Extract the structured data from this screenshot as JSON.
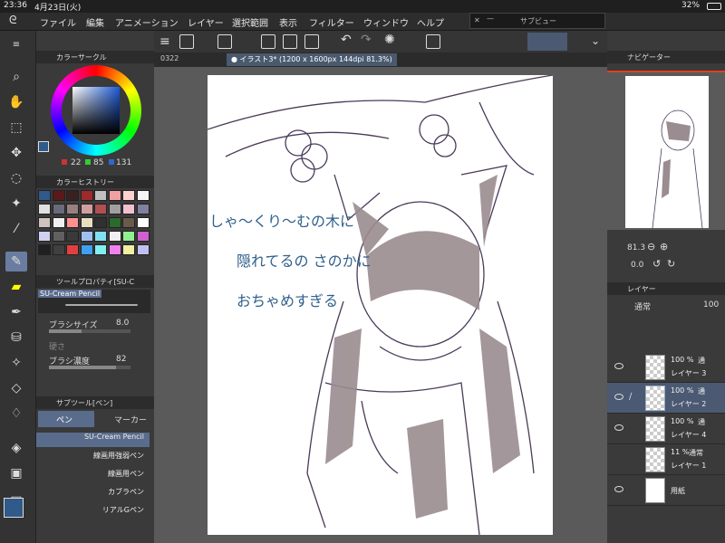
{
  "status": {
    "time": "23:36",
    "date": "4月23日(火)",
    "battery": "32%"
  },
  "menu": [
    "ファイル",
    "編集",
    "アニメーション",
    "レイヤー",
    "選択範囲",
    "表示",
    "フィルター",
    "ウィンドウ",
    "ヘルプ"
  ],
  "subview": {
    "title": "サブビュー"
  },
  "tabs": {
    "other": "0322",
    "active": "● イラスト3* (1200 x 1600px 144dpi 81.3%)"
  },
  "color_circle": {
    "title": "カラーサークル",
    "r": "22",
    "g": "85",
    "b": "131",
    "main_color": "#2f5a8a"
  },
  "color_history": {
    "title": "カラーヒストリー",
    "colors": [
      "#2f5a8a",
      "#5a1a1a",
      "#3a2020",
      "#9e2a2a",
      "#c0c0c0",
      "#f0a0a0",
      "#ffd0d0",
      "#f5f5f5",
      "#e0e0e0",
      "#6a6a7a",
      "#9a8080",
      "#d0a0a0",
      "#b05050",
      "#a0a0a0",
      "#f0c0d0",
      "#8080a0",
      "#d0c0c0",
      "#f0f0f0",
      "#ff9090",
      "#e8e0c0",
      "#303030",
      "#2a6a2a",
      "#6a5a4a",
      "#ffffff",
      "#d0d0f0",
      "#606060",
      "#3a3a3a",
      "#a0c0f0",
      "#80e0f0",
      "#f0f0f0",
      "#90f090",
      "#d060d0",
      "#202020",
      "#404040",
      "#e04040",
      "#40a0f0",
      "#80f0f0",
      "#f080f0",
      "#f0f0a0",
      "#c0c0f0"
    ]
  },
  "tool_property": {
    "title": "ツールプロパティ[SU-C",
    "brush_name": "SU-Cream Pencil",
    "size_label": "ブラシサイズ",
    "size_value": "8.0",
    "hardness_label": "硬さ",
    "density_label": "ブラシ濃度",
    "density_value": "82"
  },
  "subtool": {
    "title": "サブツール[ペン]",
    "tab_pen": "ペン",
    "tab_marker": "マーカー",
    "brushes": [
      "SU-Cream Pencil",
      "線画用強弱ペン",
      "線画用ペン",
      "カブラペン",
      "リアルGペン"
    ]
  },
  "navigator": {
    "title": "ナビゲーター",
    "zoom": "81.3",
    "rotate": "0.0"
  },
  "layers": {
    "title": "レイヤー",
    "blend": "通常",
    "opacity": "100",
    "rows": [
      {
        "pct": "100 %",
        "mode": "通",
        "name": "レイヤー 3"
      },
      {
        "pct": "100 %",
        "mode": "通",
        "name": "レイヤー 2"
      },
      {
        "pct": "100 %",
        "mode": "通",
        "name": "レイヤー 4"
      },
      {
        "pct": "11 %",
        "mode": "通常",
        "name": "レイヤー 1"
      },
      {
        "pct": "",
        "mode": "",
        "name": "用紙"
      }
    ]
  },
  "canvas_text": {
    "line1": "しゃ〜くり〜むの木に",
    "line2": "隠れてるの さのかに",
    "line3": "おちゃめすぎる"
  }
}
